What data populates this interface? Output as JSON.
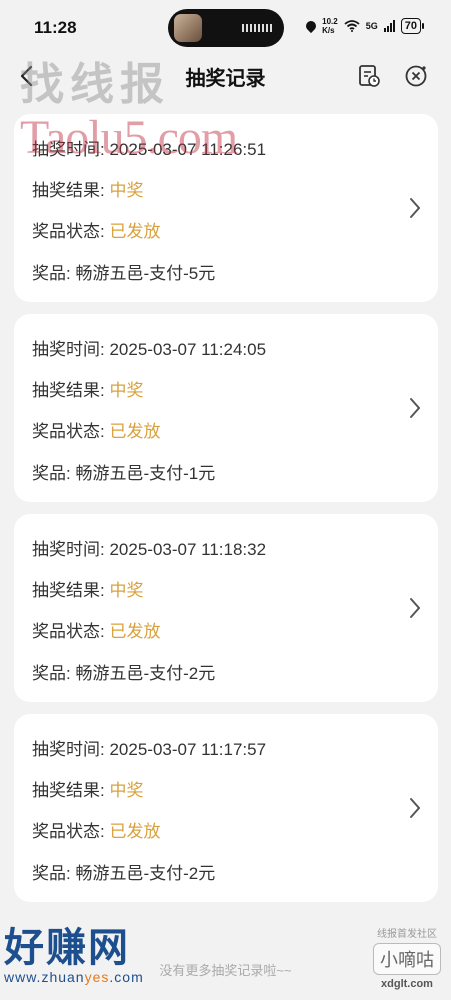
{
  "status": {
    "time": "11:28",
    "speed_top": "10.2",
    "speed_bottom": "K/s",
    "network": "5G",
    "battery": "70"
  },
  "header": {
    "title": "抽奖记录"
  },
  "labels": {
    "time": "抽奖时间:",
    "result": "抽奖结果:",
    "state": "奖品状态:",
    "prize": "奖品:"
  },
  "records": [
    {
      "time": "2025-03-07 11:26:51",
      "result": "中奖",
      "state": "已发放",
      "prize": "畅游五邑-支付-5元"
    },
    {
      "time": "2025-03-07 11:24:05",
      "result": "中奖",
      "state": "已发放",
      "prize": "畅游五邑-支付-1元"
    },
    {
      "time": "2025-03-07 11:18:32",
      "result": "中奖",
      "state": "已发放",
      "prize": "畅游五邑-支付-2元"
    },
    {
      "time": "2025-03-07 11:17:57",
      "result": "中奖",
      "state": "已发放",
      "prize": "畅游五邑-支付-2元"
    }
  ],
  "footer": {
    "text": "没有更多抽奖记录啦~~"
  },
  "watermarks": {
    "top": "找线报",
    "taolu": "Taolu5.com",
    "zhuan_big": "好赚网",
    "zhuan_small_a": "www.zhuan",
    "zhuan_small_b": "yes",
    "zhuan_small_c": ".com",
    "xdg_tiny": "线报首发社区",
    "xdg_box": "小嘀咕",
    "xdg_domain": "xdglt.com"
  },
  "colors": {
    "accent": "#d9a13c",
    "background": "#f2f2f2",
    "card": "#ffffff"
  },
  "icons": {
    "back": "chevron-left-icon",
    "doc": "document-clock-icon",
    "close": "close-circle-icon",
    "row_arrow": "chevron-right-icon"
  }
}
